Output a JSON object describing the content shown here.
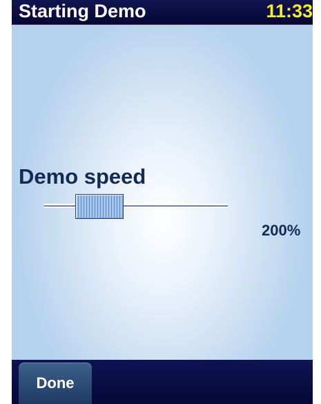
{
  "header": {
    "title": "Starting Demo",
    "time": "11:33"
  },
  "settings": {
    "demo_speed": {
      "label": "Demo speed",
      "value_text": "200%",
      "slider_fraction": 0.3
    }
  },
  "footer": {
    "done_label": "Done"
  },
  "colors": {
    "bar_background": "#0a0d46",
    "clock_text": "#f5eb2c",
    "label_text": "#122a56",
    "button_background": "#2f4c78"
  }
}
